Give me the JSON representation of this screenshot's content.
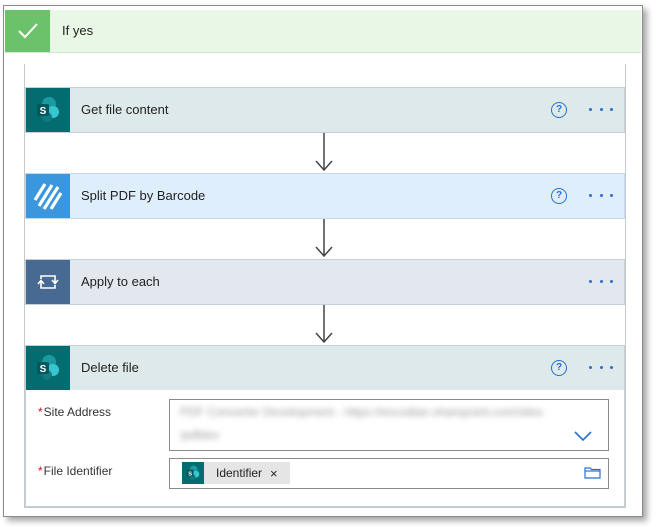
{
  "condition": {
    "title": "If yes",
    "icon": "checkmark-icon"
  },
  "actions": [
    {
      "title": "Get file content",
      "icon": "sharepoint-icon",
      "has_help": true,
      "help_glyph": "?"
    },
    {
      "title": "Split PDF by Barcode",
      "icon": "barcode-stripes-icon",
      "has_help": true,
      "help_glyph": "?"
    },
    {
      "title": "Apply to each",
      "icon": "loop-icon",
      "has_help": false
    },
    {
      "title": "Delete file",
      "icon": "sharepoint-icon",
      "has_help": true,
      "help_glyph": "?"
    }
  ],
  "delete_file": {
    "site_address": {
      "label": "Site Address",
      "required_marker": "*",
      "value_line1": "PDF Converter Development - https://encodian.sharepoint.com/sites",
      "value_line2": "/pdfdev"
    },
    "file_identifier": {
      "label": "File Identifier",
      "required_marker": "*",
      "token_label": "Identifier",
      "token_remove": "×"
    }
  },
  "colors": {
    "sharepoint_header_bg": "#dde9ea",
    "sharepoint_icon_bg": "#036c70",
    "split_pdf_header_bg": "#dfeefc",
    "split_pdf_icon_bg": "#3a96dd",
    "apply_each_header_bg": "#e3e7ee",
    "apply_each_icon_bg": "#486991",
    "accent": "#2b6fd0",
    "condition_header_bg": "#e9f7e6",
    "condition_check_bg": "#6cc16b"
  }
}
